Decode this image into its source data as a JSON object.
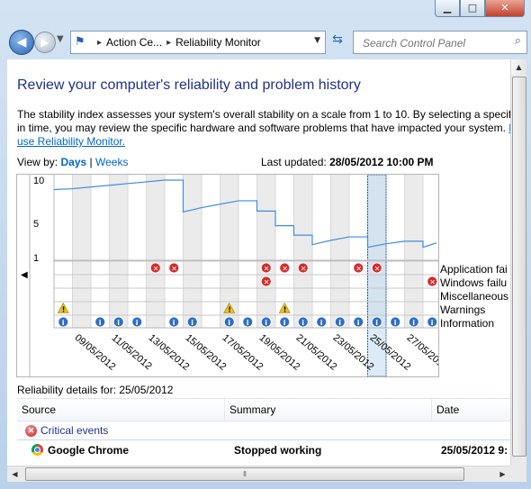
{
  "window": {
    "controls": {
      "minimize": "▁",
      "maximize": "□",
      "close": "✕"
    }
  },
  "nav": {
    "breadcrumb": [
      "Action Ce...",
      "Reliability Monitor"
    ],
    "search_placeholder": "Search Control Panel"
  },
  "page": {
    "heading": "Review your computer's reliability and problem history",
    "description_line1": "The stability index assesses your system's overall stability on a scale from 1 to 10. By selecting a specific p",
    "description_line2_prefix": "in time, you may review the specific hardware and software problems that have impacted your system.",
    "description_link_start": "H",
    "description_link_line3": "use Reliability Monitor.",
    "view_by_label": "View by:",
    "view_days": "Days",
    "view_sep": "|",
    "view_weeks": "Weeks",
    "last_updated_label": "Last updated:",
    "last_updated_value": "28/05/2012 10:00 PM"
  },
  "chart_data": {
    "type": "line",
    "y_ticks": [
      "10",
      "5",
      "1"
    ],
    "ylim": [
      1,
      10
    ],
    "dates": [
      "08/05/2012",
      "09/05/2012",
      "10/05/2012",
      "11/05/2012",
      "12/05/2012",
      "13/05/2012",
      "14/05/2012",
      "15/05/2012",
      "16/05/2012",
      "17/05/2012",
      "18/05/2012",
      "19/05/2012",
      "20/05/2012",
      "21/05/2012",
      "22/05/2012",
      "23/05/2012",
      "24/05/2012",
      "25/05/2012",
      "26/05/2012",
      "27/05/2012",
      "28/05/2012"
    ],
    "x_tick_labels": [
      "09/05/2012",
      "11/05/2012",
      "13/05/2012",
      "15/05/2012",
      "17/05/2012",
      "19/05/2012",
      "21/05/2012",
      "23/05/2012",
      "25/05/2012",
      "27/05/2012"
    ],
    "stability_index": [
      8.9,
      9.0,
      9.2,
      9.4,
      9.6,
      9.8,
      10.0,
      6.3,
      6.8,
      7.2,
      7.6,
      6.4,
      4.7,
      3.6,
      2.5,
      3.0,
      3.4,
      2.2,
      2.6,
      2.9,
      2.2
    ],
    "selected_date": "25/05/2012",
    "legend": [
      "Application fai",
      "Windows failu",
      "Miscellaneous",
      "Warnings",
      "Information"
    ],
    "events": {
      "application_failures": [
        "13/05/2012",
        "14/05/2012",
        "19/05/2012",
        "20/05/2012",
        "21/05/2012",
        "24/05/2012",
        "25/05/2012"
      ],
      "windows_failures": [
        "19/05/2012",
        "28/05/2012"
      ],
      "miscellaneous": [],
      "warnings": [
        "08/05/2012",
        "17/05/2012",
        "20/05/2012"
      ],
      "information": [
        "08/05/2012",
        "10/05/2012",
        "11/05/2012",
        "12/05/2012",
        "14/05/2012",
        "15/05/2012",
        "17/05/2012",
        "18/05/2012",
        "19/05/2012",
        "20/05/2012",
        "21/05/2012",
        "22/05/2012",
        "23/05/2012",
        "24/05/2012",
        "25/05/2012",
        "26/05/2012",
        "27/05/2012",
        "28/05/2012"
      ]
    }
  },
  "details": {
    "heading": "Reliability details for: 25/05/2012",
    "columns": [
      "Source",
      "Summary",
      "Date"
    ],
    "group": "Critical events",
    "rows": [
      {
        "source": "Google Chrome",
        "summary": "Stopped working",
        "date": "25/05/2012 9:"
      }
    ]
  }
}
